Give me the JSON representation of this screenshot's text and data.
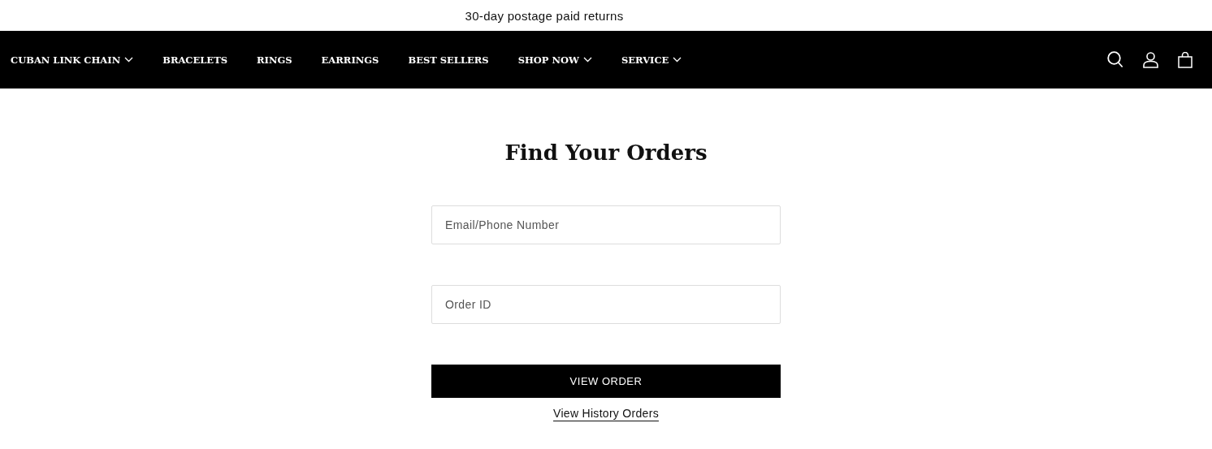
{
  "announcement": "30-day postage paid returns",
  "nav": {
    "items": [
      {
        "label": "CUBAN LINK CHAIN",
        "has_dropdown": true
      },
      {
        "label": "BRACELETS",
        "has_dropdown": false
      },
      {
        "label": "RINGS",
        "has_dropdown": false
      },
      {
        "label": "EARRINGS",
        "has_dropdown": false
      },
      {
        "label": "BEST SELLERS",
        "has_dropdown": false
      },
      {
        "label": "SHOP NOW",
        "has_dropdown": true
      },
      {
        "label": "SERVICE",
        "has_dropdown": true
      }
    ]
  },
  "form": {
    "title": "Find Your Orders",
    "fields": [
      {
        "placeholder": "Email/Phone Number"
      },
      {
        "placeholder": "Order ID"
      }
    ],
    "submit": "VIEW ORDER",
    "link": "View History Orders"
  }
}
